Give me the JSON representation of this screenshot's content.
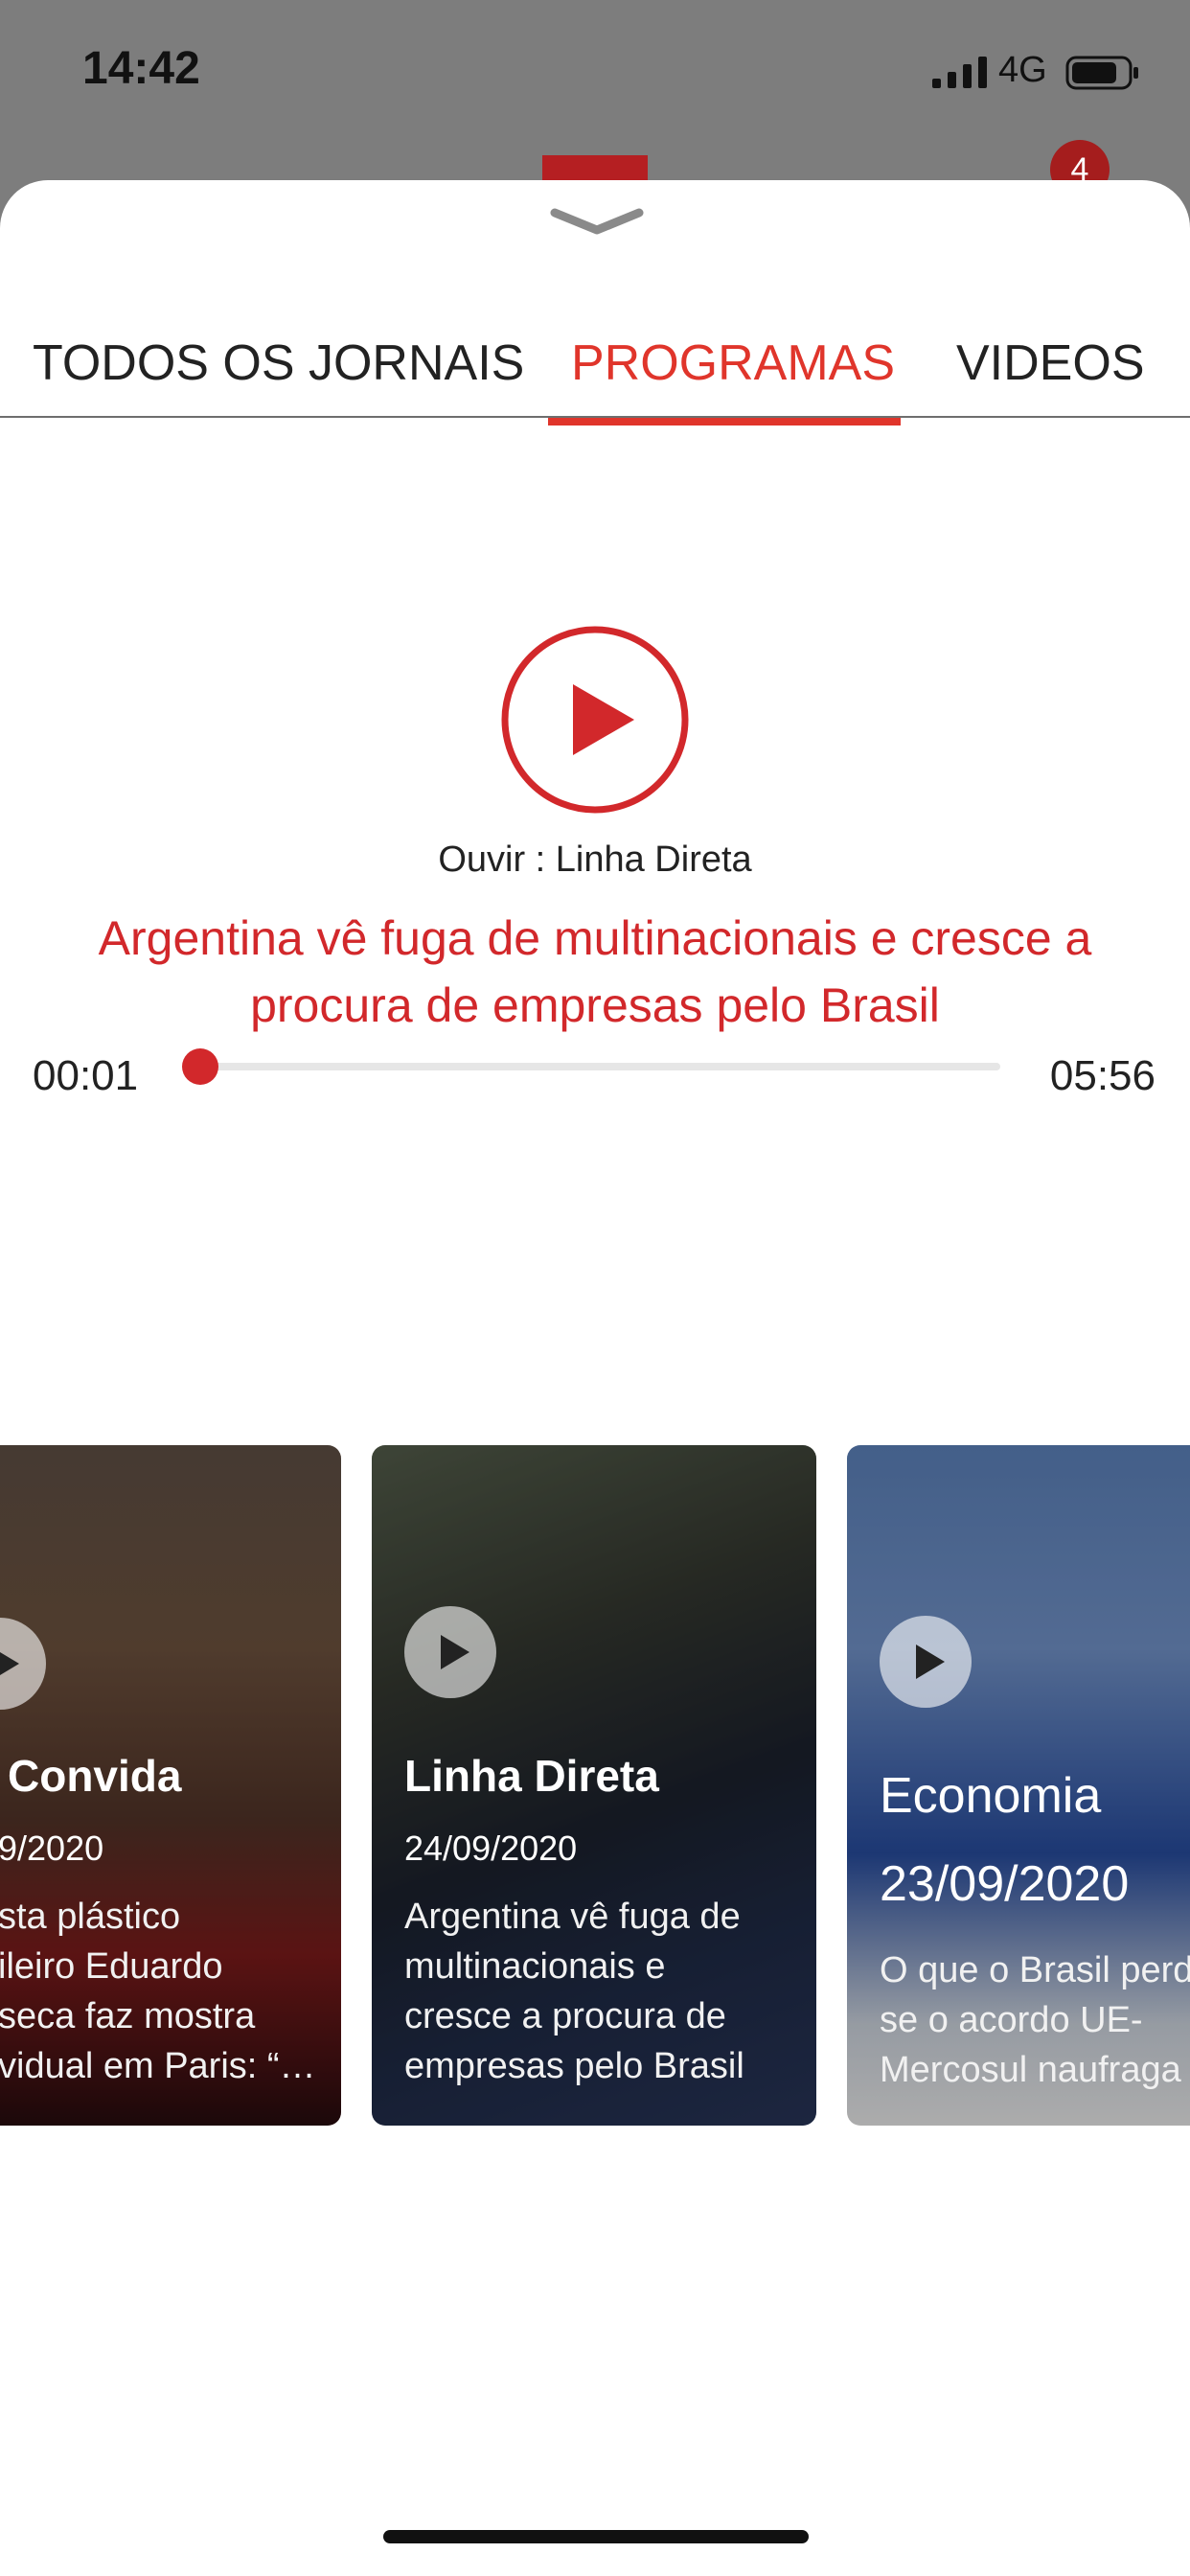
{
  "status_bar": {
    "time": "14:42",
    "network": "4G"
  },
  "header": {
    "notification_count": "4"
  },
  "tabs": [
    {
      "label": "TODOS OS JORNAIS",
      "active": false
    },
    {
      "label": "PROGRAMAS",
      "active": true
    },
    {
      "label": "VIDEOS",
      "active": false
    }
  ],
  "player": {
    "listen_label": "Ouvir : Linha Direta",
    "headline": "Argentina vê fuga de multinacionais e cresce a procura de empresas pelo Brasil",
    "elapsed": "00:01",
    "duration": "05:56",
    "progress_fraction": 0.003
  },
  "cards": [
    {
      "title": "Convida",
      "date": "9/2020",
      "description": "sta plástico\nileiro Eduardo\nseca faz mostra\nvidual em Paris: “…"
    },
    {
      "title": "Linha Direta",
      "date": "24/09/2020",
      "description": "Argentina vê fuga de\nmultinacionais e\ncresce a procura de\nempresas pelo Brasil"
    },
    {
      "title": "Economia",
      "date": "23/09/2020",
      "description": "O que o Brasil perd\nse o acordo UE-\nMercosul naufraga"
    }
  ],
  "colors": {
    "accent": "#e0352b",
    "headline_red": "#d2282b"
  }
}
